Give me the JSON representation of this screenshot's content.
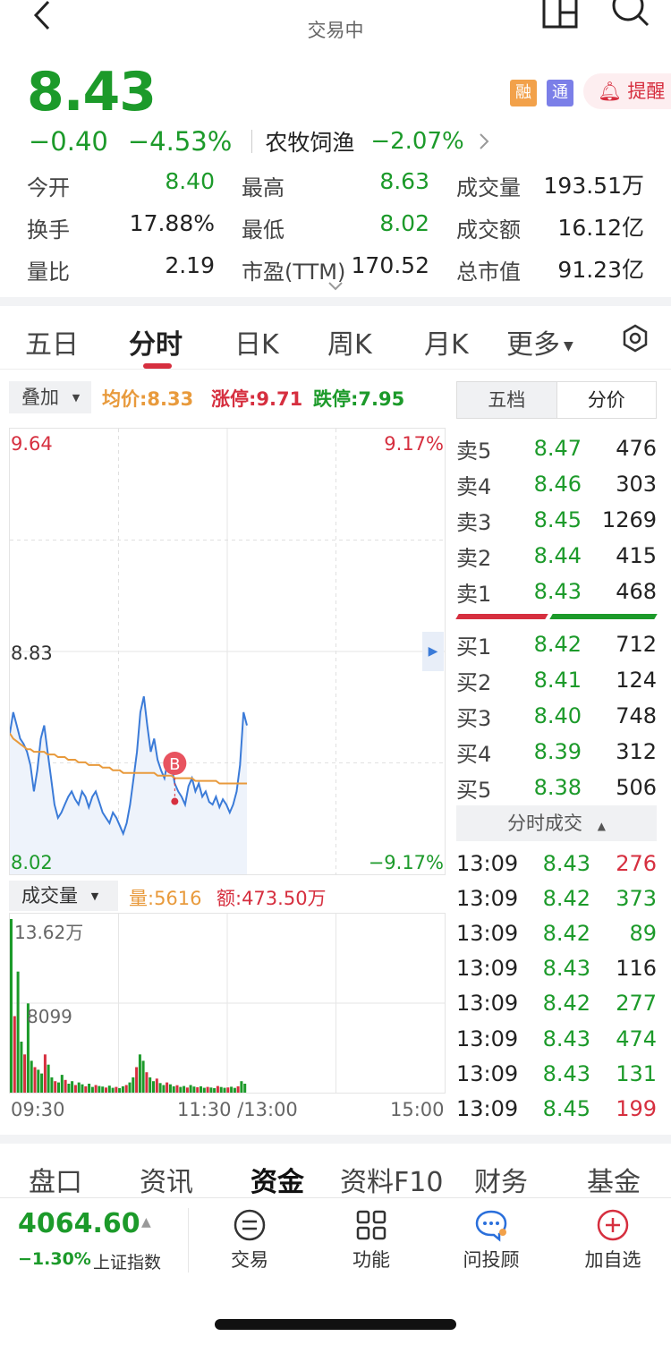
{
  "header": {
    "title": "",
    "status": "交易中"
  },
  "quote": {
    "price": "8.43",
    "change": "−0.40",
    "change_pct": "−4.53%",
    "sector": "农牧饲渔",
    "sector_pct": "−2.07%",
    "badge_rong": "融",
    "badge_tong": "通",
    "remind": "提醒"
  },
  "stats": [
    {
      "label": "今开",
      "value": "8.40",
      "color": "green"
    },
    {
      "label": "最高",
      "value": "8.63",
      "color": "green"
    },
    {
      "label": "成交量",
      "value": "193.51万",
      "color": "black"
    },
    {
      "label": "换手",
      "value": "17.88%",
      "color": "black"
    },
    {
      "label": "最低",
      "value": "8.02",
      "color": "green"
    },
    {
      "label": "成交额",
      "value": "16.12亿",
      "color": "black"
    },
    {
      "label": "量比",
      "value": "2.19",
      "color": "black"
    },
    {
      "label": "市盈(TTM)",
      "value": "170.52",
      "color": "black"
    },
    {
      "label": "总市值",
      "value": "91.23亿",
      "color": "black"
    }
  ],
  "tabs": [
    "五日",
    "分时",
    "日K",
    "周K",
    "月K",
    "更多"
  ],
  "toolbar": {
    "overlay": "叠加",
    "avg": "均价:8.33",
    "limit_up": "涨停:9.71",
    "limit_down": "跌停:7.95"
  },
  "chart_data": {
    "type": "line",
    "y_max_label": "9.64",
    "y_mid_label": "8.83",
    "y_min_label": "8.02",
    "pct_max_label": "9.17%",
    "pct_min_label": "−9.17%",
    "ylim": [
      8.02,
      9.64
    ],
    "x_labels": [
      "09:30",
      "11:30 /13:00",
      "15:00"
    ],
    "marker": "B",
    "price_series": [
      8.52,
      8.6,
      8.55,
      8.5,
      8.48,
      8.45,
      8.4,
      8.3,
      8.38,
      8.5,
      8.55,
      8.45,
      8.35,
      8.25,
      8.2,
      8.22,
      8.25,
      8.28,
      8.3,
      8.27,
      8.25,
      8.3,
      8.28,
      8.24,
      8.28,
      8.3,
      8.26,
      8.22,
      8.2,
      8.18,
      8.22,
      8.2,
      8.17,
      8.14,
      8.18,
      8.25,
      8.35,
      8.45,
      8.6,
      8.66,
      8.55,
      8.45,
      8.5,
      8.42,
      8.38,
      8.35,
      8.42,
      8.4,
      8.33,
      8.3,
      8.28,
      8.25,
      8.32,
      8.35,
      8.3,
      8.33,
      8.28,
      8.3,
      8.26,
      8.25,
      8.28,
      8.24,
      8.27,
      8.25,
      8.22,
      8.25,
      8.3,
      8.4,
      8.6,
      8.55
    ],
    "avg_series": [
      8.52,
      8.5,
      8.49,
      8.48,
      8.47,
      8.46,
      8.46,
      8.45,
      8.45,
      8.45,
      8.45,
      8.44,
      8.44,
      8.44,
      8.43,
      8.43,
      8.43,
      8.42,
      8.42,
      8.42,
      8.41,
      8.41,
      8.41,
      8.4,
      8.4,
      8.4,
      8.4,
      8.39,
      8.39,
      8.39,
      8.38,
      8.38,
      8.38,
      8.37,
      8.37,
      8.37,
      8.37,
      8.37,
      8.37,
      8.37,
      8.37,
      8.37,
      8.37,
      8.36,
      8.36,
      8.36,
      8.36,
      8.36,
      8.35,
      8.35,
      8.35,
      8.35,
      8.35,
      8.35,
      8.34,
      8.34,
      8.34,
      8.34,
      8.34,
      8.34,
      8.34,
      8.33,
      8.33,
      8.33,
      8.33,
      8.33,
      8.33,
      8.33,
      8.33,
      8.33
    ],
    "volume": {
      "label": "成交量",
      "qty": "量:5616",
      "amount": "额:473.50万",
      "max_label": "13.62万",
      "mid_label": "8099",
      "ylim": [
        0,
        136200
      ],
      "bars": [
        136200,
        60000,
        95000,
        40000,
        30000,
        70000,
        25000,
        20000,
        18000,
        15000,
        30000,
        22000,
        12000,
        9000,
        8000,
        14000,
        10000,
        7000,
        9000,
        6000,
        8000,
        6500,
        5000,
        7000,
        4500,
        6000,
        5200,
        4800,
        4000,
        5500,
        3800,
        4500,
        3600,
        5000,
        6000,
        8000,
        12000,
        20000,
        30000,
        25000,
        16000,
        12000,
        9000,
        11000,
        7500,
        6000,
        8000,
        6500,
        5000,
        5800,
        4500,
        5200,
        4000,
        6000,
        4800,
        4200,
        5000,
        3800,
        4500,
        4000,
        3600,
        5200,
        4400,
        3800,
        4100,
        4600,
        3700,
        5000,
        9000,
        7000
      ],
      "bar_colors": "alternating"
    }
  },
  "orderbook": {
    "tabs": [
      "五档",
      "分价"
    ],
    "asks": [
      {
        "label": "卖5",
        "price": "8.47",
        "vol": "476"
      },
      {
        "label": "卖4",
        "price": "8.46",
        "vol": "303"
      },
      {
        "label": "卖3",
        "price": "8.45",
        "vol": "1269"
      },
      {
        "label": "卖2",
        "price": "8.44",
        "vol": "415"
      },
      {
        "label": "卖1",
        "price": "8.43",
        "vol": "468"
      }
    ],
    "bids": [
      {
        "label": "买1",
        "price": "8.42",
        "vol": "712"
      },
      {
        "label": "买2",
        "price": "8.41",
        "vol": "124"
      },
      {
        "label": "买3",
        "price": "8.40",
        "vol": "748"
      },
      {
        "label": "买4",
        "price": "8.39",
        "vol": "312"
      },
      {
        "label": "买5",
        "price": "8.38",
        "vol": "506"
      }
    ],
    "ticks_header": "分时成交",
    "ticks": [
      {
        "time": "13:09",
        "price": "8.43",
        "vol": "276",
        "color": "#d62f3f"
      },
      {
        "time": "13:09",
        "price": "8.42",
        "vol": "373",
        "color": "#1c9a2a"
      },
      {
        "time": "13:09",
        "price": "8.42",
        "vol": "89",
        "color": "#1c9a2a"
      },
      {
        "time": "13:09",
        "price": "8.43",
        "vol": "116",
        "color": "#222222"
      },
      {
        "time": "13:09",
        "price": "8.42",
        "vol": "277",
        "color": "#1c9a2a"
      },
      {
        "time": "13:09",
        "price": "8.43",
        "vol": "474",
        "color": "#1c9a2a"
      },
      {
        "time": "13:09",
        "price": "8.43",
        "vol": "131",
        "color": "#1c9a2a"
      },
      {
        "time": "13:09",
        "price": "8.45",
        "vol": "199",
        "color": "#d62f3f"
      }
    ]
  },
  "bottom_tabs": [
    "盘口",
    "资讯",
    "资金",
    "资料F10",
    "财务",
    "基金"
  ],
  "bottom_bar": {
    "index_value": "4064.60",
    "index_change": "−1.30%",
    "index_name": "上证指数",
    "items": [
      "交易",
      "功能",
      "问投顾",
      "加自选"
    ]
  },
  "colors": {
    "up": "#d62f3f",
    "down": "#1c9a2a",
    "avg_line": "#e89a3c",
    "price_line": "#3b7bd8"
  }
}
